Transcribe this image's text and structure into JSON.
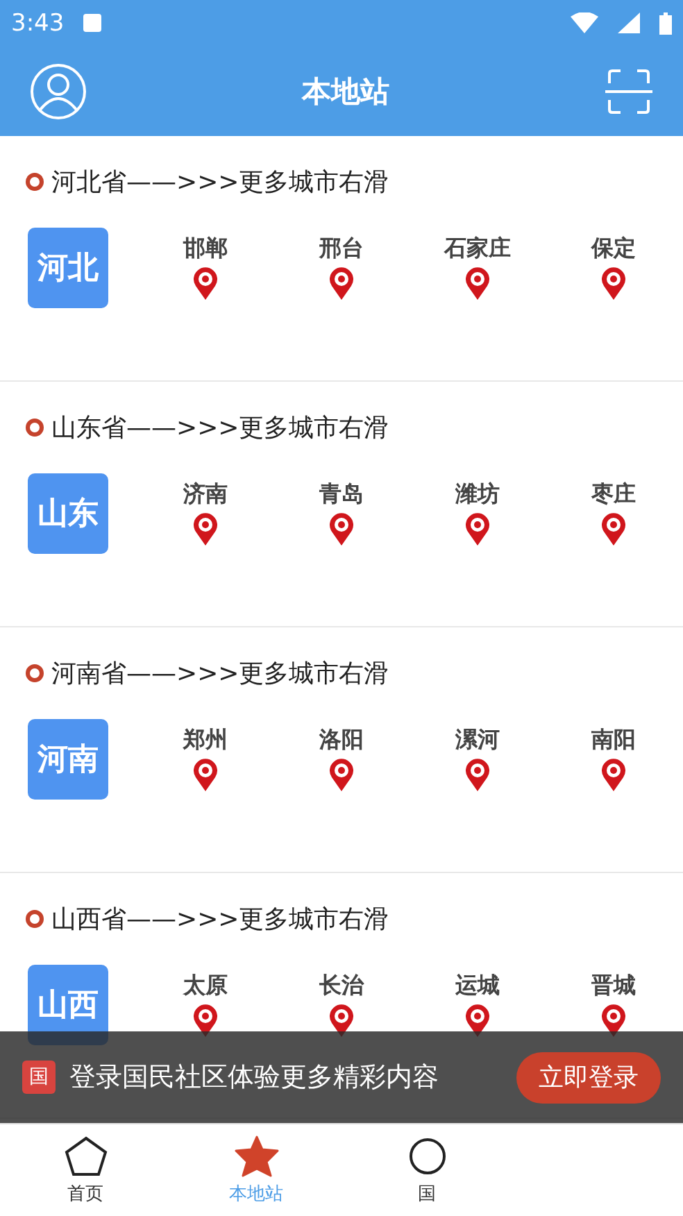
{
  "status_bar": {
    "time": "3:43"
  },
  "header": {
    "title": "本地站"
  },
  "provinces": [
    {
      "title": "河北省——>>>更多城市右滑",
      "badge": "河北",
      "cities": [
        "邯郸",
        "邢台",
        "石家庄",
        "保定"
      ]
    },
    {
      "title": "山东省——>>>更多城市右滑",
      "badge": "山东",
      "cities": [
        "济南",
        "青岛",
        "潍坊",
        "枣庄"
      ]
    },
    {
      "title": "河南省——>>>更多城市右滑",
      "badge": "河南",
      "cities": [
        "郑州",
        "洛阳",
        "漯河",
        "南阳"
      ]
    },
    {
      "title": "山西省——>>>更多城市右滑",
      "badge": "山西",
      "cities": [
        "太原",
        "长治",
        "运城",
        "晋城"
      ]
    }
  ],
  "login_banner": {
    "icon_text": "国",
    "message": "登录国民社区体验更多精彩内容",
    "button": "立即登录"
  },
  "tabs": [
    {
      "label": "首页",
      "kind": "pentagon",
      "selected": false
    },
    {
      "label": "本地站",
      "kind": "star",
      "selected": true
    },
    {
      "label": "国",
      "kind": "other",
      "selected": false
    }
  ]
}
